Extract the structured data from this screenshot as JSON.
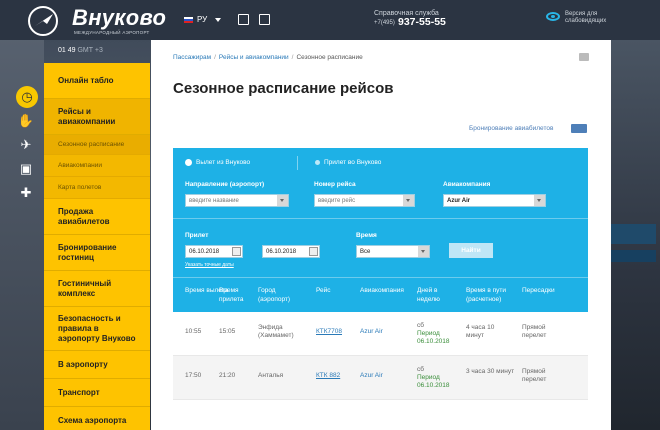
{
  "header": {
    "logo_text": "Внуково",
    "logo_subtitle": "МЕЖДУНАРОДНЫЙ АЭРОПОРТ",
    "language": "РУ",
    "hotline_label": "Справочная служба",
    "hotline_prefix": "+7(495)",
    "hotline_number": "937-55-55",
    "vision_line1": "Версия для",
    "vision_line2": "слабовидящих"
  },
  "clock": {
    "time": "01 49",
    "tz": "GMT +3"
  },
  "sidebar": {
    "items": [
      {
        "label": "Онлайн табло"
      },
      {
        "label": "Рейсы и авиакомпании"
      },
      {
        "label": "Продажа авиабилетов"
      },
      {
        "label": "Бронирование гостиниц"
      },
      {
        "label": "Гостиничный комплекс"
      },
      {
        "label": "Безопасность и правила в аэропорту Внуково"
      },
      {
        "label": "В аэропорту"
      },
      {
        "label": "Транспорт"
      },
      {
        "label": "Схема аэропорта"
      }
    ],
    "sub_items": [
      {
        "label": "Сезонное расписание"
      },
      {
        "label": "Авиакомпании"
      },
      {
        "label": "Карта полетов"
      }
    ]
  },
  "breadcrumb": {
    "items": [
      "Пассажирам",
      "Рейсы и авиакомпании"
    ],
    "current": "Сезонное расписание"
  },
  "page_title": "Сезонное расписание рейсов",
  "booking_link": "Бронирование авиабилетов",
  "search": {
    "radio_departure": "Вылет из Внуково",
    "radio_arrival": "Прилет во Внуково",
    "direction_label": "Направление (аэропорт)",
    "direction_placeholder": "введите название",
    "flight_label": "Номер рейса",
    "flight_placeholder": "введите рейс",
    "airline_label": "Авиакомпания",
    "airline_value": "Azur Air",
    "arrival_label": "Прилет",
    "date_from": "06.10.2018",
    "date_to": "06.10.2018",
    "time_label": "Время",
    "time_value": "Все",
    "find_button": "Найти",
    "exact_dates_link": "Указать точные даты"
  },
  "table": {
    "headers": [
      "Время вылета",
      "Время прилета",
      "Город (аэропорт)",
      "Рейс",
      "Авиакомпания",
      "Дней в неделю",
      "Время в пути (расчетное)",
      "Пересадки"
    ],
    "rows": [
      {
        "dep": "10:55",
        "arr": "15:05",
        "city": "Энфида (Хаммамет)",
        "flight": "КТК7708",
        "airline": "Azur Air",
        "day": "сб",
        "period": "Период",
        "period_date": "06.10.2018",
        "duration": "4 часа 10 минут",
        "transfer": "Прямой перелет"
      },
      {
        "dep": "17:50",
        "arr": "21:20",
        "city": "Анталья",
        "flight": "КТК 882",
        "airline": "Azur Air",
        "day": "сб",
        "period": "Период",
        "period_date": "06.10.2018",
        "duration": "3 часа 30 минут",
        "transfer": "Прямой перелет"
      }
    ]
  }
}
